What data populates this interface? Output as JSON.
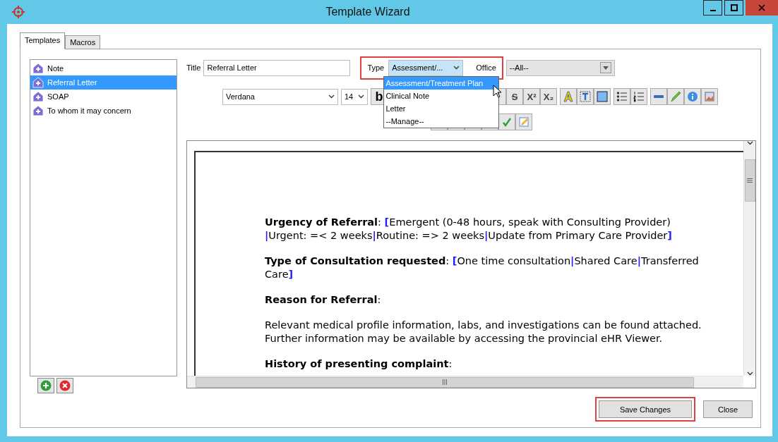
{
  "window": {
    "title": "Template Wizard"
  },
  "tabs": [
    {
      "label": "Templates",
      "selected": true
    },
    {
      "label": "Macros",
      "selected": false
    }
  ],
  "templates": [
    {
      "label": "Note",
      "selected": false
    },
    {
      "label": "Referral Letter",
      "selected": true
    },
    {
      "label": "SOAP",
      "selected": false
    },
    {
      "label": "To whom it may concern",
      "selected": false
    }
  ],
  "form": {
    "title_label": "Title",
    "title_value": "Referral Letter",
    "type_label": "Type",
    "type_value": "Assessment/...",
    "type_annotated": true,
    "office_label": "Office",
    "office_value": "--All--"
  },
  "type_dropdown": {
    "expanded": true,
    "options": [
      {
        "label": "Assessment/Treatment Plan",
        "selected": true
      },
      {
        "label": "Clinical Note",
        "selected": false
      },
      {
        "label": "Letter",
        "selected": false
      },
      {
        "label": "--Manage--",
        "selected": false
      }
    ]
  },
  "font": {
    "family": "Verdana",
    "size": "14"
  },
  "toolbar": {
    "bold": "b",
    "strike": "S",
    "superscript": "X²",
    "subscript": "X₂"
  },
  "document": [
    [
      {
        "kind": "label",
        "text": "Urgency of Referral"
      },
      {
        "kind": "text",
        "text": ": "
      },
      {
        "kind": "bracket",
        "text": "["
      },
      {
        "kind": "text",
        "text": "Emergent (0-48 hours, speak with Consulting Provider) "
      },
      {
        "kind": "bracket",
        "text": "|"
      },
      {
        "kind": "text",
        "text": "Urgent: =< 2 weeks"
      },
      {
        "kind": "bracket",
        "text": "|"
      },
      {
        "kind": "text",
        "text": "Routine: => 2 weeks"
      },
      {
        "kind": "bracket",
        "text": "|"
      },
      {
        "kind": "text",
        "text": "Update from Primary Care Provider"
      },
      {
        "kind": "bracket",
        "text": "]"
      }
    ],
    [
      {
        "kind": "label",
        "text": "Type of Consultation requested"
      },
      {
        "kind": "text",
        "text": ": "
      },
      {
        "kind": "bracket",
        "text": "["
      },
      {
        "kind": "text",
        "text": "One time consultation"
      },
      {
        "kind": "bracket",
        "text": "|"
      },
      {
        "kind": "text",
        "text": "Shared Care"
      },
      {
        "kind": "bracket",
        "text": "|"
      },
      {
        "kind": "text",
        "text": "Transferred Care"
      },
      {
        "kind": "bracket",
        "text": "]"
      }
    ],
    [
      {
        "kind": "label",
        "text": "Reason for Referral"
      },
      {
        "kind": "text",
        "text": ":"
      }
    ],
    [
      {
        "kind": "text",
        "text": "Relevant medical profile information, labs, and investigations can be found attached. Further information may be available by accessing the provincial eHR Viewer."
      }
    ],
    [
      {
        "kind": "label",
        "text": "History of presenting complaint"
      },
      {
        "kind": "text",
        "text": ":"
      }
    ]
  ],
  "buttons": [
    {
      "label": "Save Changes",
      "annotated": true
    },
    {
      "label": "Close",
      "annotated": false
    }
  ]
}
